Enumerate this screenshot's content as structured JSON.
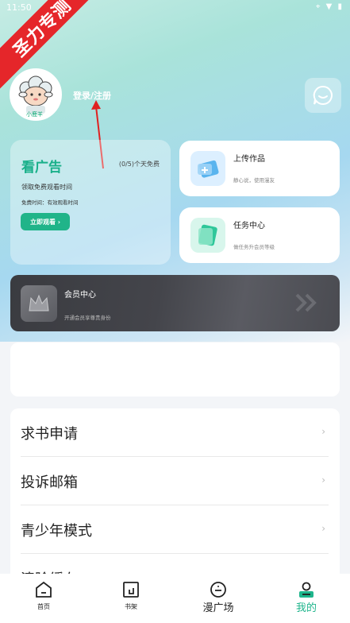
{
  "status_bar": {
    "time": "11:50",
    "icons": "⌖ ▼ ▮"
  },
  "ribbon": {
    "text": "圣力专测"
  },
  "profile": {
    "avatar_caption": "小鹿羊",
    "login_label": "登录/注册"
  },
  "ad_card": {
    "title": "看广告",
    "count": "(0/5)个天免费",
    "desc": "领取免费观看时间",
    "free_time": "免费时间：有效观看时间",
    "button": "立即观看 ›"
  },
  "upload_card": {
    "title": "上传作品",
    "subtitle": "静心说，使用漫友"
  },
  "task_card": {
    "title": "任务中心",
    "subtitle": "做任务升会员等级"
  },
  "vip_card": {
    "title": "会员中心",
    "subtitle": "开通会员享尊贵身份"
  },
  "menu": {
    "items": [
      {
        "label": "求书申请"
      },
      {
        "label": "投诉邮箱"
      },
      {
        "label": "青少年模式"
      },
      {
        "label": "清除缓存"
      }
    ],
    "chevron": "›"
  },
  "tabs": [
    {
      "label": "首页"
    },
    {
      "label": "书架"
    },
    {
      "label": "漫广场"
    },
    {
      "label": "我的"
    }
  ],
  "colors": {
    "accent": "#1fb58c",
    "ribbon": "#e5262a",
    "vip_bg": "#44454b"
  }
}
